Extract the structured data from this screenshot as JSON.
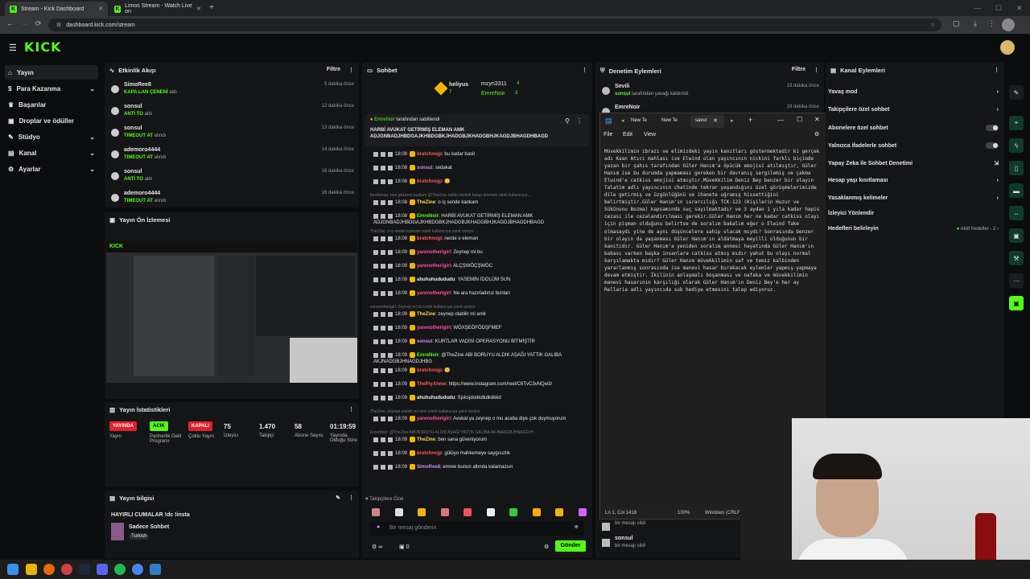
{
  "browser": {
    "tabs": [
      {
        "label": "Stream - Kick Dashboard"
      },
      {
        "label": "Limos Stream - Watch Live on"
      }
    ],
    "url": "dashboard.kick.com/stream"
  },
  "brand": "KICK",
  "sidebar": {
    "items": [
      {
        "label": "Yayın"
      },
      {
        "label": "Para Kazanma"
      },
      {
        "label": "Başarılar"
      },
      {
        "label": "Droplar ve ödüller"
      },
      {
        "label": "Stüdyo"
      },
      {
        "label": "Kanal"
      },
      {
        "label": "Ayarlar"
      }
    ]
  },
  "activity": {
    "title": "Etkinlik Akışı",
    "filter": "Filtre",
    "items": [
      {
        "name": "SimoRee8",
        "detail_b": "KAPA LAN ÇENENİ",
        "detail": "aldı",
        "time": "5 dakika önce"
      },
      {
        "name": "sonsul",
        "detail_b": "ANTİ TO",
        "detail": "aldı",
        "time": "12 dakika önce"
      },
      {
        "name": "sonsul",
        "detail_b": "TIMEOUT AT",
        "detail": "alındı",
        "time": "13 dakika önce"
      },
      {
        "name": "ademoro4444",
        "detail_b": "TIMEOUT AT",
        "detail": "alındı",
        "time": "14 dakika önce"
      },
      {
        "name": "sonsul",
        "detail_b": "ANTİ TO",
        "detail": "aldı",
        "time": "16 dakika önce"
      },
      {
        "name": "ademoro4444",
        "detail_b": "TIMEOUT AT",
        "detail": "alındı",
        "time": "16 dakika önce"
      }
    ]
  },
  "preview": {
    "title": "Yayın Ön İzlemesi"
  },
  "stats": {
    "title": "Yayın İstatistikleri",
    "pills": [
      {
        "label": "YAYINDA",
        "sub": "Yayın",
        "color": "#e0202e"
      },
      {
        "label": "ACIK",
        "sub": "Partnerlik Gelir Programı",
        "color": "#53fc18"
      },
      {
        "label": "KAPALI",
        "sub": "Çoklu Yayın",
        "color": "#e0202e"
      }
    ],
    "values": [
      {
        "value": "75",
        "label": "İzleyici"
      },
      {
        "value": "1.470",
        "label": "Takipçi"
      },
      {
        "value": "58",
        "label": "Abone Sayısı"
      },
      {
        "value": "01:19:59",
        "label": "Yayında Olduğu Süre"
      }
    ]
  },
  "info": {
    "title": "Yayın bilgisi",
    "stream_title": "HAYIRLI CUMALAR !dc !insta",
    "category": "Sadece Sohbet",
    "tag": "Turkish"
  },
  "chat": {
    "title": "Sohbet",
    "top_users": [
      {
        "name": "heliyus",
        "count": "7"
      },
      {
        "name": "mzyn3311",
        "count": "4"
      },
      {
        "name": "EmreNoir",
        "count": "3"
      }
    ],
    "pinned_by": "EmreNoir",
    "pinned_suffix": "tarafından sabitlendi",
    "pinned_text": "HARBİ AVUKAT GETİRMİŞ ELEMAN AMK ADJGNBADJHBDGAJKHBDGBKJHADGBJKHADGBHJKAGDJBHAGDHBAGD",
    "lines": [
      {
        "time": "18:08",
        "user": "bratchnojp",
        "color": "#ff5a5a",
        "text": ": bu kadar basit"
      },
      {
        "time": "18:08",
        "user": "sonsul",
        "color": "#c78cff",
        "text": ": sedakat"
      },
      {
        "time": "18:08",
        "user": "bratchnojp",
        "color": "#ff5a5a",
        "text": ": 🙂"
      },
      {
        "sys": "İbrahimqq: ben gözümü buldum @TheZine sahte elwindi bulup dövmek isimli kullanıcıya..."
      },
      {
        "time": "18:08",
        "user": "TheZine",
        "color": "#ffd54a",
        "text": ": o iş sende kankam"
      },
      {
        "time": "18:08",
        "user": "EmreNoir",
        "color": "#53fc18",
        "text": ": HARBİ AVUKAT GETİRMİŞ ELEMAN AMK ADJGNBADJHBDGAJKHBDGBKJHADGBJKHADGBHJKAGDJBHAGDHBAGD"
      },
      {
        "sys": "TheZine: o iş sende kankam isimli kullanıcıya yanıt veriyor"
      },
      {
        "time": "18:08",
        "user": "bratchnojp",
        "color": "#ff5a5a",
        "text": ": nerde o eleman"
      },
      {
        "time": "18:09",
        "user": "yarenotherigirl",
        "color": "#ff4fa3",
        "text": ": Zeynep mi bu"
      },
      {
        "time": "18:09",
        "user": "yarenotherigirl",
        "color": "#ff4fa3",
        "text": ": ALÇŞWÖÇŞWÖC"
      },
      {
        "time": "18:09",
        "user": "ahuhuhudududu",
        "color": "#eeeeee",
        "text": ": YASEMİN İDOLÜM SUN"
      },
      {
        "time": "18:09",
        "user": "yarenotherigirl",
        "color": "#ff4fa3",
        "text": ": Ne ara hazırladınız bunları"
      },
      {
        "sys": "yarenotherigirl: Zeynep mi bu isimli kullanıcıya yanıt veriyor"
      },
      {
        "time": "18:09",
        "user": "TheZine",
        "color": "#ffd54a",
        "text": ": zeynep olabilir mi amk"
      },
      {
        "time": "18:09",
        "user": "yarenotherigirl",
        "color": "#ff4fa3",
        "text": ": WÖXŞEÖFÖDŞFMEF"
      },
      {
        "time": "18:09",
        "user": "sonsul",
        "color": "#c78cff",
        "text": ": KURTLAR VADİSİ OPERASYONU BİTMİŞTİR"
      },
      {
        "time": "18:09",
        "user": "EmreNoir",
        "color": "#53fc18",
        "text": ": @TheZine ABİ BORUYU ALDIK AŞAĞI YATTIK GALİBA AKJNADGBJHNAGDJHBG"
      },
      {
        "time": "18:09",
        "user": "bratchnojp",
        "color": "#ff5a5a",
        "text": ": 🙂"
      },
      {
        "time": "18:09",
        "user": "ThePiyAhme",
        "color": "#ff5a5a",
        "text": ": https://www.instagram.com/reel/C6TvC3vNQw3/"
      },
      {
        "time": "18:09",
        "user": "ahuhuhudududu",
        "color": "#eeeeee",
        "text": ": Sjsksjdodkdkdkdkkd"
      },
      {
        "sys": "TheZine: zeynep olabilir mi amk isimli kullanıcıya yanıt veriyor"
      },
      {
        "time": "18:09",
        "user": "yarenotherigirl",
        "color": "#ff4fa3",
        "text": ": Avukat ya zeynep o mu acaba diye çok duymuyorum"
      },
      {
        "sys": "EmreNoir: @TheZine ABİ BORUYU ALDIK AŞAĞI YATTIK GALİBA AKJNADGBJHNAGDJH..."
      },
      {
        "time": "18:09",
        "user": "TheZine",
        "color": "#ffd54a",
        "text": ": ben sana güveniyorum"
      },
      {
        "time": "18:09",
        "user": "bratchnojp",
        "color": "#ff5a5a",
        "text": ": gülüyo mahkemeye saygısızlık"
      },
      {
        "time": "18:09",
        "user": "SimoRee8",
        "color": "#c78cff",
        "text": ": emree bunun altında kalamazsın"
      }
    ],
    "emotes_label": "Takipçilere Özel",
    "input_placeholder": "Bir mesaj gönderin",
    "counter": "0",
    "send": "Gönder"
  },
  "mod": {
    "title": "Denetim Eylemleri",
    "filter": "Filtre",
    "items": [
      {
        "name": "Sevili",
        "detail_b": "sonsul",
        "detail": "tarafından yasağı kaldırıldı",
        "time": "19 dakika önce"
      },
      {
        "name": "EmreNoir",
        "detail": "",
        "time": "19 dakika önce"
      }
    ],
    "bottom": [
      {
        "name": "",
        "detail": "bir mesajı sildi"
      },
      {
        "name": "sonsul",
        "detail": "bir mesajı sildi"
      }
    ]
  },
  "notepad": {
    "tabs": [
      "New Te",
      "New Te",
      "savur"
    ],
    "menu": [
      "File",
      "Edit",
      "View"
    ],
    "text": "Müvekkilimin ibrazı ve elimizdeki yayın kanıtları göstermektedir ki gerçek adı Kaan Atıcı mahlası ise Elwind olan yayıncının nickini farklı biçimde yazan bir şahıs tarafından Güler Hanım'a öpücük emojisi atılmıştır, Güler Hanım ise bu durumda yapmaması gereken bir davranış sergilemiş ve çakma Elwind'e catkiss emojisi atmıştır.Müvekkilim Deniz Bey benzer bir olayın Talatim adlı yayıncının chatinde tekrar yaşandığını özel görüşmelerimizde dile getirmiş ve üzgünlüğünü ve ihanete uğramış hissettiğini belirtmiştir.Güler Hanım'ın ısrarcılığı TCK-123 (Kişilerin Huzur ve Sükûnunu Bozma) kapsamında suç sayılmaktadır ve 3 aydan 1 yıla kadar hapis cezası ile cezalandırılması gerekir.Güler Hanım her ne kadar catkiss olayı için pişman olduğunu belirtse de soralım bakalım eğer o Elwind fake olmasaydı yine de aynı düşüncelere sahip olacak mıydı? Sonrasında benzer bir olayın da yaşanması Güler Hanım'ın aldatmaya meyilli olduğunun bir kanıtıdır. Güler Hanım'a yeniden soralım annesi hayatında Güler Hanım'ın babası varken başka insanlara catkiss atmış mıdır yahut bu olayı normal karşılamakta mıdır? Güler Hanım müvekkilimin saf ve temiz kalbinden yararlanmış sonrasında ise manevi hasar bırakacak eylemler yapmış-yapmaya devam etmiştir. İkilinin anlaşmalı boşanması ve nafaka ve müvekkilimin manevi hasarının karşılığı olarak Güler Hanım'ın Deniz Bey'e her ay Rellaria adlı yayıncıda sub hediye etmesini talep ediyoruz.",
    "status_pos": "Ln 1, Col 1418",
    "status_zoom": "100%",
    "status_eol": "Windows (CRLF)"
  },
  "channel": {
    "title": "Kanal Eylemleri",
    "items": [
      {
        "label": "Yavaş mod",
        "kind": "arrow"
      },
      {
        "label": "Takipçilere özel sohbet",
        "kind": "arrow"
      },
      {
        "label": "Abonelere özel sohbet",
        "kind": "toggle"
      },
      {
        "label": "Yalnızca ifadelerle sohbet",
        "kind": "toggle"
      },
      {
        "label": "Yapay Zeka ile Sohbet Denetimi",
        "kind": "ext"
      },
      {
        "label": "Hesap yaşı kısıtlaması",
        "kind": "arrow"
      },
      {
        "label": "Yasaklanmış kelimeler",
        "kind": "arrow"
      },
      {
        "label": "İzleyici Yönlendir",
        "kind": "none"
      },
      {
        "label": "Hedefleri belirleyin",
        "kind": "goal",
        "extra": "Aktif hedefler - 2"
      }
    ]
  },
  "colors": {
    "accent": "#53fc18",
    "live": "#e0202e",
    "bg": "#0b0c0d",
    "panel": "#141517"
  }
}
